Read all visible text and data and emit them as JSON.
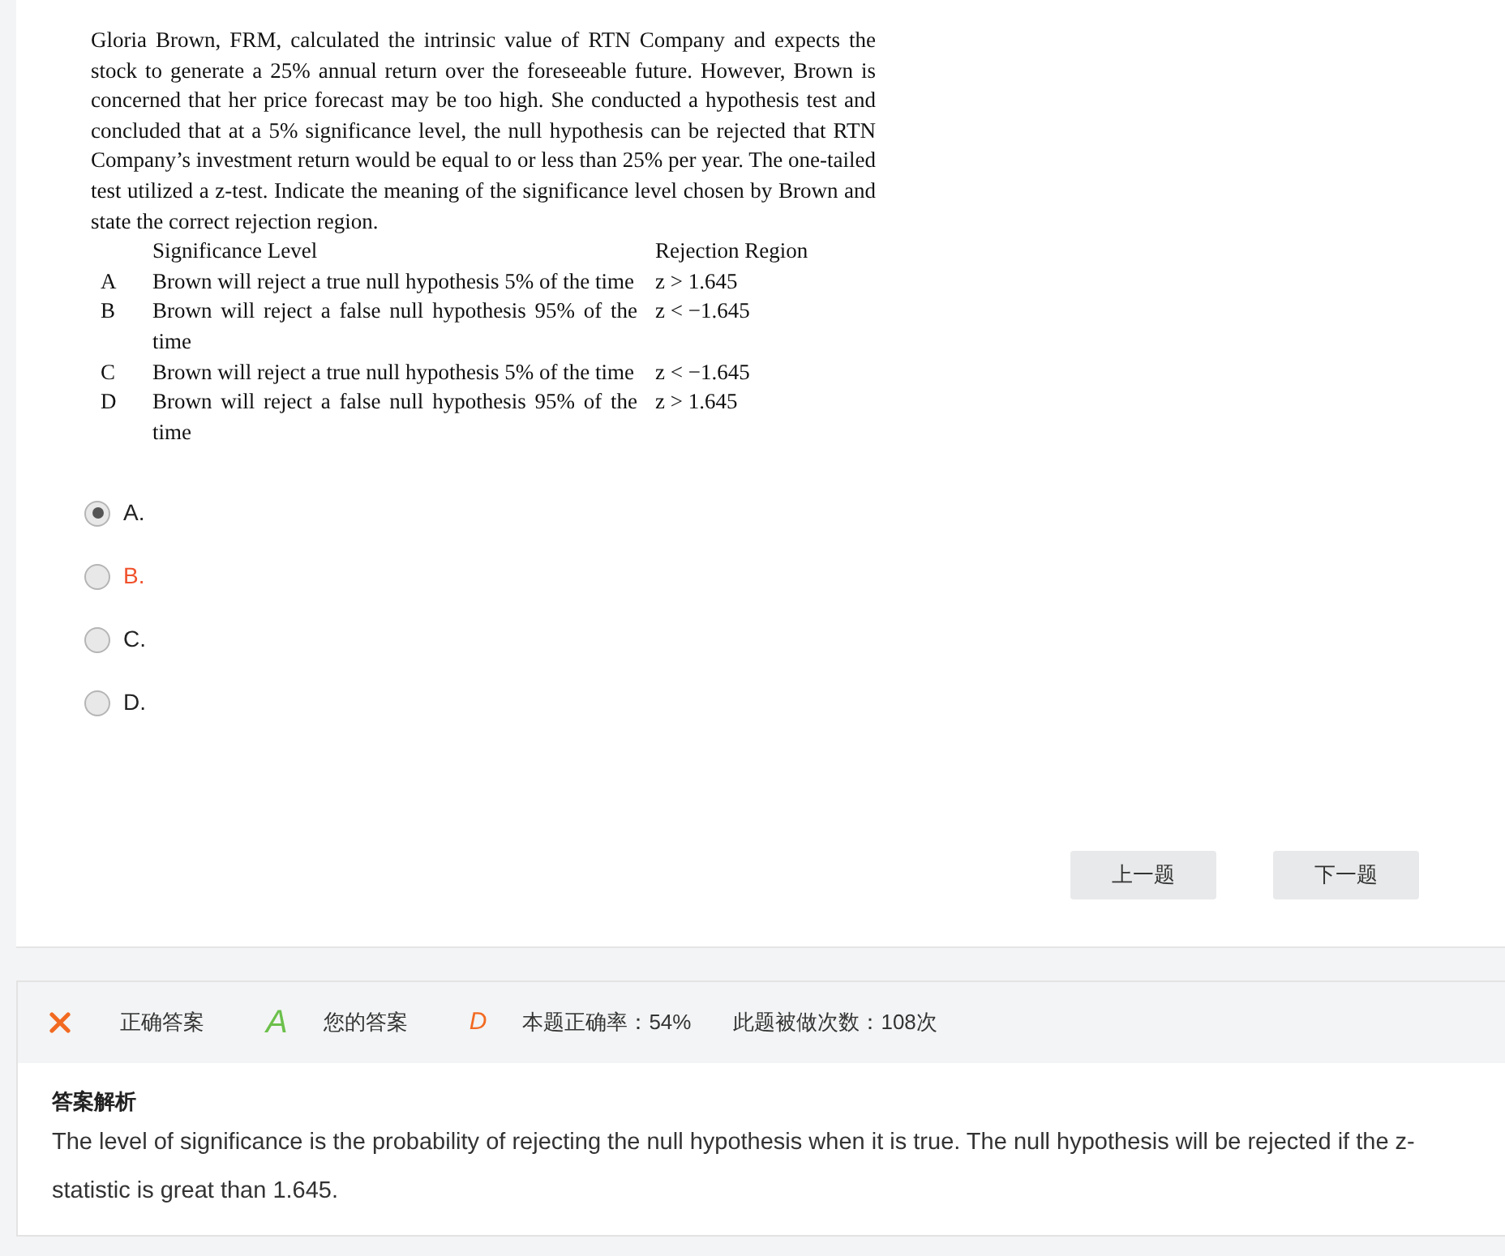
{
  "question": {
    "stem": "Gloria Brown, FRM, calculated the intrinsic value of RTN Company and expects the stock to generate a 25% annual return over the foreseeable future. However, Brown is concerned that her price forecast may be too high. She conducted a hypothesis test and concluded that at a 5% significance level, the null hypothesis can be rejected that RTN Company’s investment return would be equal to or less than 25% per year. The one-tailed test utilized a z-test. Indicate the meaning of the significance level chosen by Brown and state the correct rejection region.",
    "columns": [
      "Significance Level",
      "Rejection Region"
    ],
    "rows": [
      {
        "letter": "A",
        "level": "Brown will reject a true null hypothesis 5% of the time",
        "region": "z > 1.645"
      },
      {
        "letter": "B",
        "level": "Brown will reject a false null hypothesis 95% of the time",
        "region": "z < −1.645"
      },
      {
        "letter": "C",
        "level": "Brown will reject a true null hypothesis 5% of the time",
        "region": "z < −1.645"
      },
      {
        "letter": "D",
        "level": "Brown will reject a false null hypothesis 95% of the time",
        "region": "z > 1.645"
      }
    ]
  },
  "options": [
    {
      "label": "A.",
      "selected": true,
      "marked": false
    },
    {
      "label": "B.",
      "selected": false,
      "marked": true
    },
    {
      "label": "C.",
      "selected": false,
      "marked": false
    },
    {
      "label": "D.",
      "selected": false,
      "marked": false
    }
  ],
  "buttons": [
    "上一题",
    "下一题"
  ],
  "result": {
    "correct": false,
    "correct_label": "正确答案",
    "correct_answer": "A",
    "your_label": "您的答案",
    "your_answer": "D",
    "accuracy": "本题正确率：54%",
    "attempts": "此题被做次数：108次"
  },
  "analysis": {
    "title": "答案解析",
    "text": "The level of significance is the probability of rejecting the null hypothesis when it is true. The null hypothesis will be rejected if the z-statistic is great than 1.645."
  }
}
